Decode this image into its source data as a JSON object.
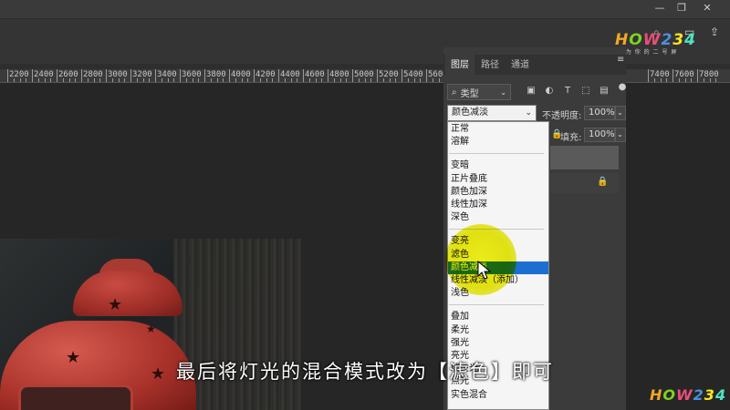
{
  "window": {
    "minimize": "—",
    "restore": "❐",
    "close": "✕"
  },
  "ruler": {
    "labels": [
      "2200",
      "2400",
      "2600",
      "2800",
      "3000",
      "3200",
      "3400",
      "3600",
      "3800",
      "4000",
      "4200",
      "4400",
      "4600",
      "4800",
      "5000",
      "5200",
      "5400",
      "5600",
      "5800",
      "6000",
      "6200",
      "6400",
      "6600",
      "6800",
      "7000",
      "7200",
      "7400",
      "7600",
      "7800"
    ]
  },
  "logo": {
    "text": "HOW234",
    "sub": "当 前 为 你 的 二 号 屏",
    "colors": [
      "#f5a623",
      "#7ed321",
      "#e94e77",
      "#4a90e2",
      "#f8e71c",
      "#50e3c2"
    ]
  },
  "panel": {
    "tabs": [
      "图层",
      "路径",
      "通道"
    ],
    "filter_label": "类型",
    "filter_icons": [
      "image-filter-icon",
      "adjustment-filter-icon",
      "type-filter-icon",
      "shape-filter-icon",
      "smart-object-filter-icon"
    ],
    "blend_mode": "颜色减淡",
    "opacity_label": "不透明度:",
    "opacity_value": "100%",
    "fill_label": "填充:",
    "fill_value": "100%"
  },
  "dropdown": {
    "groups": [
      [
        "正常",
        "溶解"
      ],
      [
        "变暗",
        "正片叠底",
        "颜色加深",
        "线性加深",
        "深色"
      ],
      [
        "变亮",
        "滤色",
        "颜色减淡",
        "线性减淡（添加）",
        "浅色"
      ],
      [
        "叠加",
        "柔光",
        "强光",
        "亮光",
        "线性光",
        "点光",
        "实色混合"
      ]
    ],
    "selected": "颜色减淡"
  },
  "subtitle": "最后将灯光的混合模式改为【滤色】即可",
  "colors": {
    "highlight_blue": "#1c6fd1",
    "cursor_yellow": "#eaea12"
  }
}
